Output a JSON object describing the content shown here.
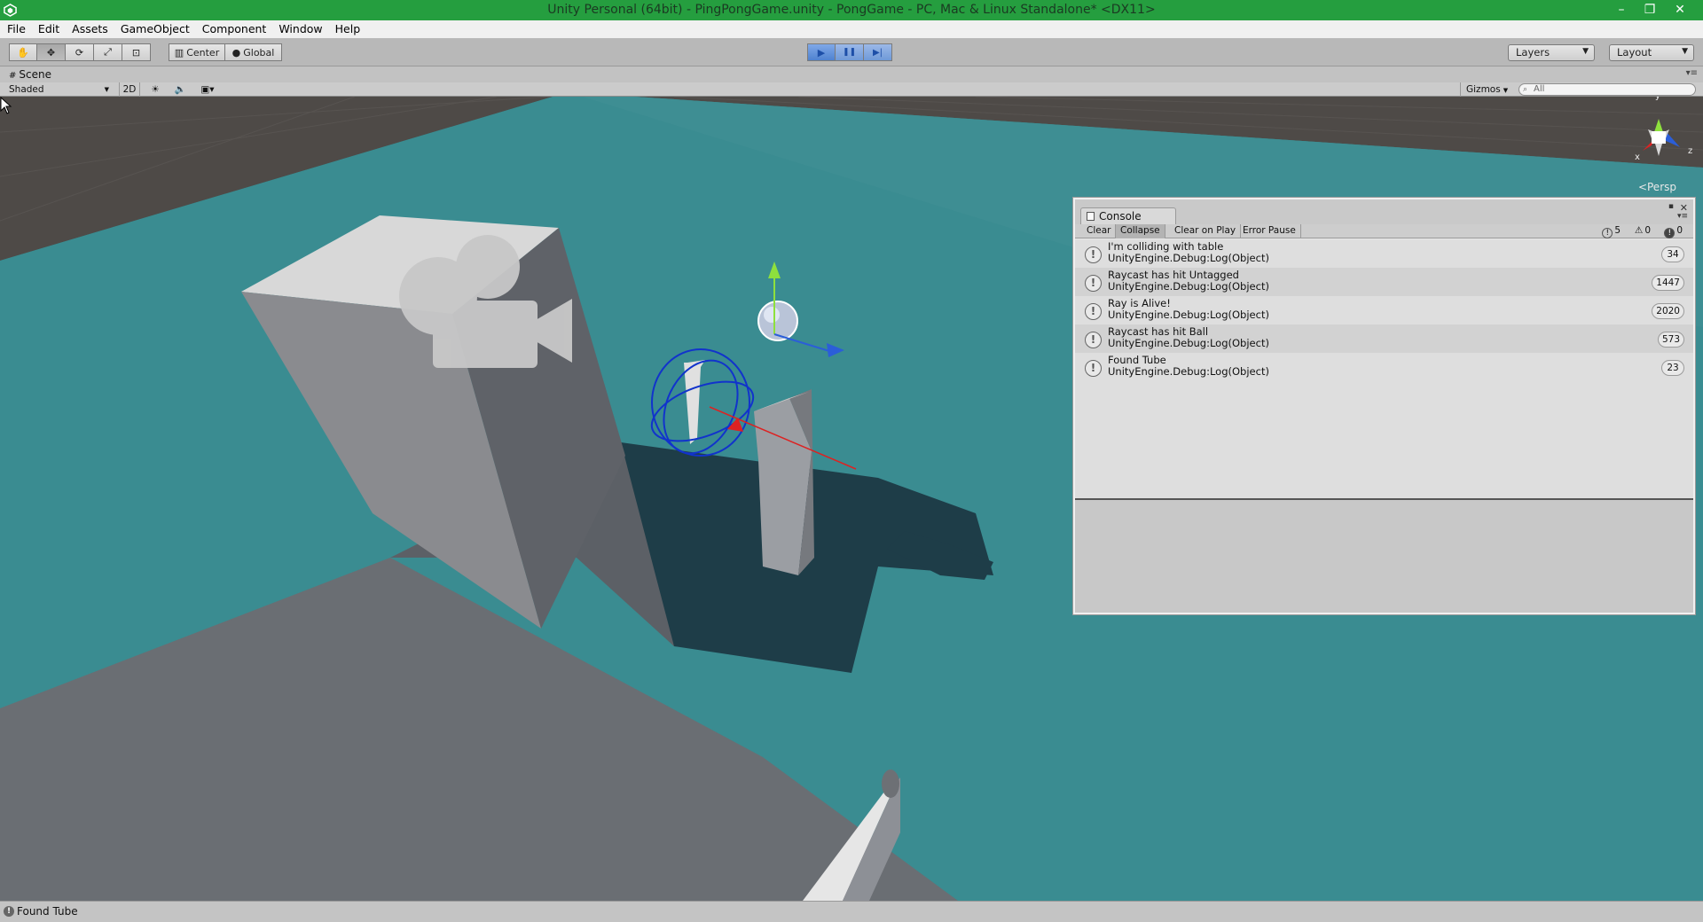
{
  "window": {
    "title": "Unity Personal (64bit) - PingPongGame.unity - PongGame - PC, Mac & Linux Standalone* <DX11>",
    "minimize": "–",
    "restore": "❐",
    "close": "✕"
  },
  "menu": [
    "File",
    "Edit",
    "Assets",
    "GameObject",
    "Component",
    "Window",
    "Help"
  ],
  "toolbar": {
    "tools": [
      {
        "name": "hand-icon",
        "glyph": "✋"
      },
      {
        "name": "move-icon",
        "glyph": "✥"
      },
      {
        "name": "rotate-icon",
        "glyph": "⟳"
      },
      {
        "name": "scale-icon",
        "glyph": "⤢"
      },
      {
        "name": "rect-icon",
        "glyph": "⊡"
      }
    ],
    "pivot_label": "Center",
    "space_label": "Global",
    "play_glyph": "▶",
    "pause_glyph": "❚❚",
    "step_glyph": "▶|",
    "layers_label": "Layers",
    "layout_label": "Layout"
  },
  "scene": {
    "tab_label": "Scene",
    "shading_mode": "Shaded",
    "mode_2d": "2D",
    "gizmos_label": "Gizmos",
    "search_placeholder": "All",
    "projection_label": "Persp",
    "axis_labels": {
      "x": "x",
      "y": "y",
      "z": "z"
    }
  },
  "console": {
    "tab_label": "Console",
    "buttons": {
      "clear": "Clear",
      "collapse": "Collapse",
      "clear_on_play": "Clear on Play",
      "error_pause": "Error Pause"
    },
    "counts": {
      "log": "5",
      "warning": "0",
      "error": "0"
    },
    "entries": [
      {
        "message": "I'm colliding with table",
        "source": "UnityEngine.Debug:Log(Object)",
        "count": "34"
      },
      {
        "message": "Raycast has hit Untagged",
        "source": "UnityEngine.Debug:Log(Object)",
        "count": "1447"
      },
      {
        "message": "Ray is Alive!",
        "source": "UnityEngine.Debug:Log(Object)",
        "count": "2020"
      },
      {
        "message": "Raycast has hit Ball",
        "source": "UnityEngine.Debug:Log(Object)",
        "count": "573"
      },
      {
        "message": "Found Tube",
        "source": "UnityEngine.Debug:Log(Object)",
        "count": "23"
      }
    ]
  },
  "status": {
    "message": "Found Tube"
  }
}
